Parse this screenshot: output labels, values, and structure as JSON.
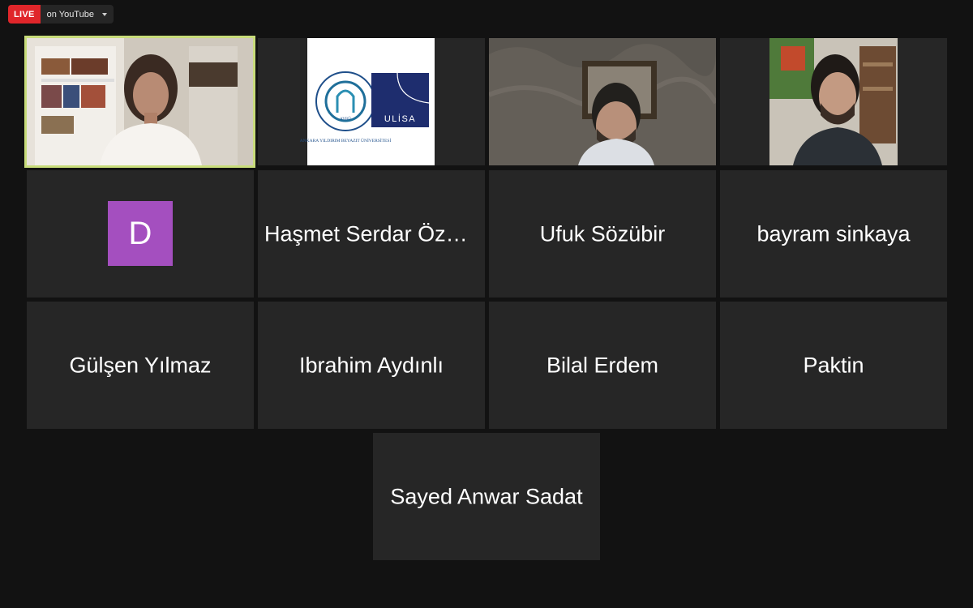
{
  "live": {
    "badge": "LIVE",
    "destination": "on YouTube"
  },
  "participants": {
    "p1_avatar_letter": "D",
    "p2": "Haşmet Serdar Özdemir",
    "p3": "Ufuk Sözübir",
    "p4": "bayram sinkaya",
    "p5": "Gülşen Yılmaz",
    "p6": "Ibrahim Aydınlı",
    "p7": "Bilal Erdem",
    "p8": "Paktin",
    "p9": "Sayed Anwar Sadat"
  },
  "logo": {
    "ayb_ring_text": "ANKARA YILDIRIM BEYAZIT ÜNİVERSİTESİ",
    "ayb_short": "AYBÜ",
    "ulisa": "ULİSA"
  },
  "colors": {
    "background": "#121212",
    "tile": "#262626",
    "active_border": "#c8dc7a",
    "live_red": "#e0262a",
    "avatar_purple": "#a44fbf",
    "ulisa_navy": "#1e2d6e"
  }
}
